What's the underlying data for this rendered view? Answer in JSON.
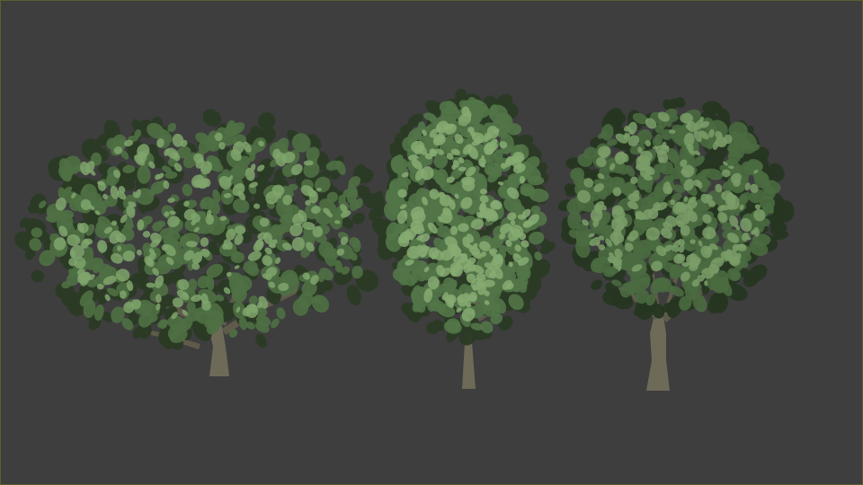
{
  "scene": {
    "background_color": "#3e3e3e",
    "frame_border_color": "#5c5f2e",
    "trees": [
      {
        "name": "broad-spreading-tree",
        "trunk_color": "#6e6a58",
        "leaf_dark": "#2a3a24",
        "leaf_mid": "#4f7044",
        "leaf_light": "#7fa46c"
      },
      {
        "name": "narrow-tall-tree",
        "trunk_color": "#6e6a58",
        "leaf_dark": "#2a3a24",
        "leaf_mid": "#527548",
        "leaf_light": "#86ab72"
      },
      {
        "name": "round-crown-tree",
        "trunk_color": "#6e6a58",
        "leaf_dark": "#263621",
        "leaf_mid": "#4a6a40",
        "leaf_light": "#7a9e68"
      }
    ]
  }
}
